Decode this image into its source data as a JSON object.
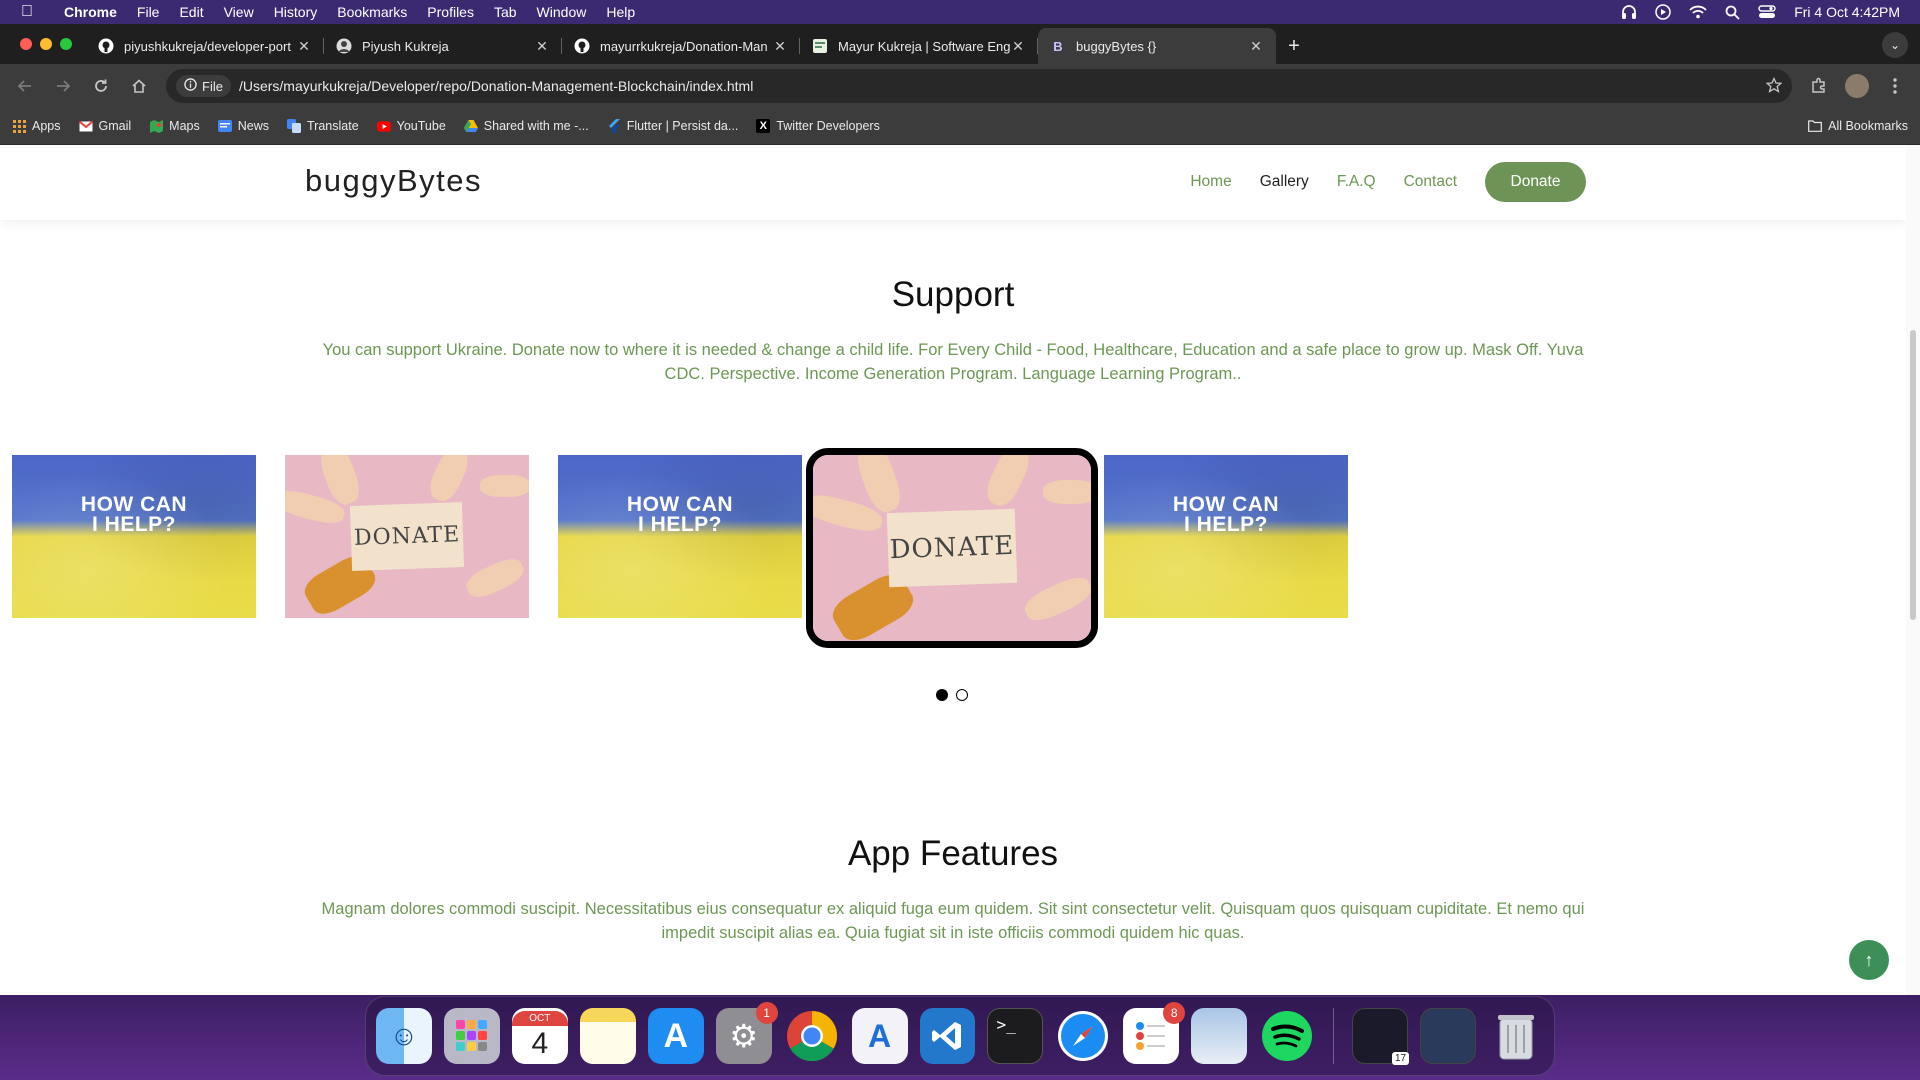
{
  "menubar": {
    "app": "Chrome",
    "items": [
      "File",
      "Edit",
      "View",
      "History",
      "Bookmarks",
      "Profiles",
      "Tab",
      "Window",
      "Help"
    ],
    "datetime": "Fri 4 Oct  4:42PM"
  },
  "tabs": [
    {
      "title": "piyushkukreja/developer-port",
      "icon": "github-icon"
    },
    {
      "title": "Piyush Kukreja",
      "icon": "avatar-icon"
    },
    {
      "title": "mayurrkukreja/Donation-Man",
      "icon": "github-icon"
    },
    {
      "title": "Mayur Kukreja | Software Eng",
      "icon": "site-icon"
    },
    {
      "title": "buggyBytes {}",
      "icon": "b-icon"
    }
  ],
  "address": {
    "chip": "File",
    "url": "/Users/mayurkukreja/Developer/repo/Donation-Management-Blockchain/index.html"
  },
  "bookmarks": [
    {
      "label": "Apps",
      "icon": "apps-grid-icon",
      "color": "#e8a33d"
    },
    {
      "label": "Gmail",
      "icon": "gmail-icon",
      "color": "#ea4335"
    },
    {
      "label": "Maps",
      "icon": "maps-icon",
      "color": "#34a853"
    },
    {
      "label": "News",
      "icon": "news-icon",
      "color": "#4285f4"
    },
    {
      "label": "Translate",
      "icon": "translate-icon",
      "color": "#4285f4"
    },
    {
      "label": "YouTube",
      "icon": "youtube-icon",
      "color": "#ff0000"
    },
    {
      "label": "Shared with me -...",
      "icon": "drive-icon",
      "color": "#fbbc04"
    },
    {
      "label": "Flutter | Persist da...",
      "icon": "flutter-icon",
      "color": "#42a5f5"
    },
    {
      "label": "Twitter Developers",
      "icon": "x-icon",
      "color": "#000000"
    }
  ],
  "all_bookmarks": "All Bookmarks",
  "site": {
    "logo": "buggyBytes",
    "nav": [
      "Home",
      "Gallery",
      "F.A.Q",
      "Contact"
    ],
    "donate": "Donate"
  },
  "support": {
    "title": "Support",
    "text": "You can support Ukraine. Donate now to where it is needed & change a child life. For Every Child - Food, Healthcare, Education and a safe place to grow up. Mask Off. Yuva CDC. Perspective. Income Generation Program. Language Learning Program.."
  },
  "gallery": {
    "flag_text_1": "HOW CAN",
    "flag_text_2": "I HELP?",
    "donate_text": "DONATE",
    "active_slide": 1,
    "slide_count": 2
  },
  "features": {
    "title": "App Features",
    "text": "Magnam dolores commodi suscipit. Necessitatibus eius consequatur ex aliquid fuga eum quidem. Sit sint consectetur velit. Quisquam quos quisquam cupiditate. Et nemo qui impedit suscipit alias ea. Quia fugiat sit in iste officiis commodi quidem hic quas."
  },
  "dock": {
    "calendar_month": "OCT",
    "calendar_day": "4",
    "settings_badge": "1",
    "reminders_badge": "8",
    "calendar_mini": "17"
  },
  "colors": {
    "accent_green": "#6d9456",
    "text_green": "#6e9755",
    "menubar": "#3b2a72",
    "backtop": "#3e8e57"
  }
}
